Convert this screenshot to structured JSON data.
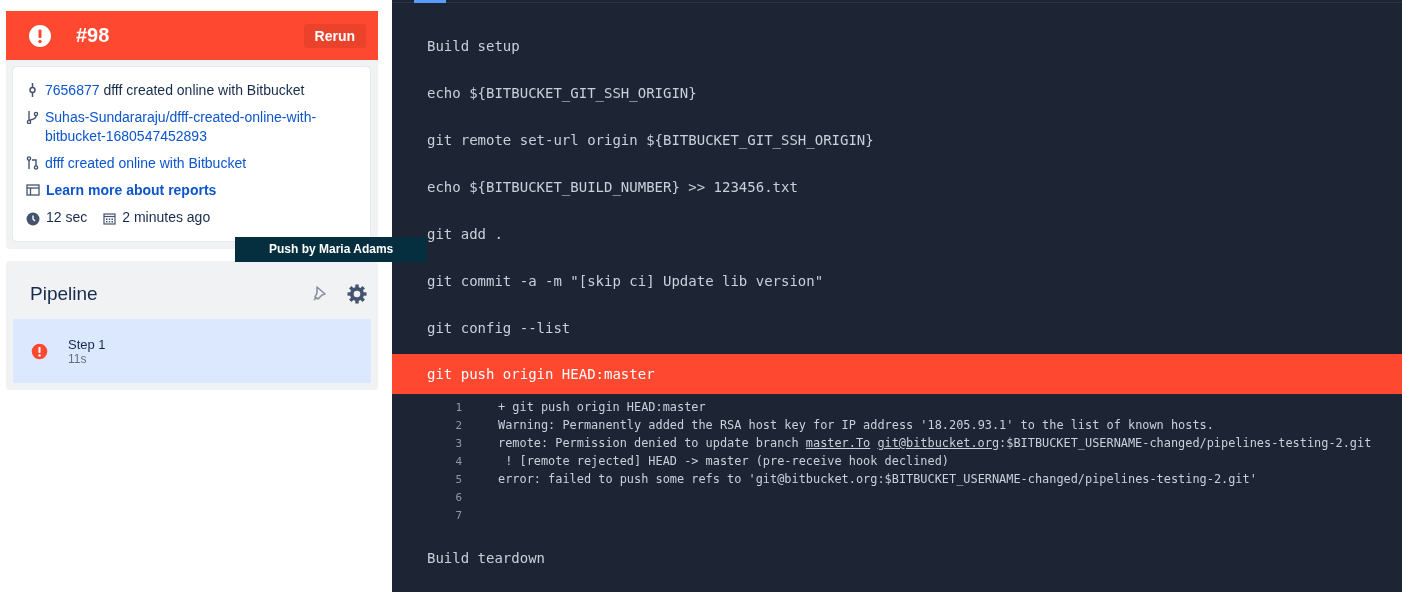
{
  "build": {
    "number": "#98",
    "rerun_button": "Rerun",
    "commit": {
      "hash": "7656877",
      "message": "dfff created online with Bitbucket"
    },
    "branch": "Suhas-Sundararaju/dfff-created-online-with-bitbucket-1680547452893",
    "pull_request": "dfff created online with Bitbucket",
    "reports_link": "Learn more about reports",
    "duration": "12 sec",
    "started": "2 minutes ago"
  },
  "tooltip": "Push by Maria Adams",
  "pipeline": {
    "title": "Pipeline",
    "steps": [
      {
        "name": "Step 1",
        "duration": "11s",
        "selected": true
      }
    ]
  },
  "log": [
    {
      "kind": "section",
      "text": "Build setup"
    },
    {
      "kind": "command",
      "text": "echo ${BITBUCKET_GIT_SSH_ORIGIN}"
    },
    {
      "kind": "command",
      "text": "git remote set-url origin ${BITBUCKET_GIT_SSH_ORIGIN}"
    },
    {
      "kind": "command",
      "text": "echo ${BITBUCKET_BUILD_NUMBER} >> 123456.txt"
    },
    {
      "kind": "command",
      "text": "git add ."
    },
    {
      "kind": "command",
      "text": "git commit -a -m \"[skip ci] Update lib version\""
    },
    {
      "kind": "command",
      "text": "git config --list"
    },
    {
      "kind": "failed",
      "text": "git push origin HEAD:master",
      "output": [
        {
          "number": "1",
          "text": "+ git push origin HEAD:master"
        },
        {
          "number": "2",
          "text": "Warning: Permanently added the RSA host key for IP address '18.205.93.1' to the list of known hosts."
        },
        {
          "number": "3",
          "text": "remote: Permission denied to update branch ",
          "links": [
            {
              "text": "master.To"
            },
            {
              "text": "git@bitbucket.org",
              "after": ":$BITBUCKET_USERNAME-changed/pipelines-testing-2.git"
            }
          ]
        },
        {
          "number": "4",
          "text": " ! [remote rejected] HEAD -> master (pre-receive hook declined)"
        },
        {
          "number": "5",
          "text": "error: failed to push some refs to 'git@bitbucket.org:$BITBUCKET_USERNAME-changed/pipelines-testing-2.git'"
        },
        {
          "number": "6"
        },
        {
          "number": "7"
        }
      ]
    },
    {
      "kind": "section",
      "text": "Build teardown"
    }
  ]
}
